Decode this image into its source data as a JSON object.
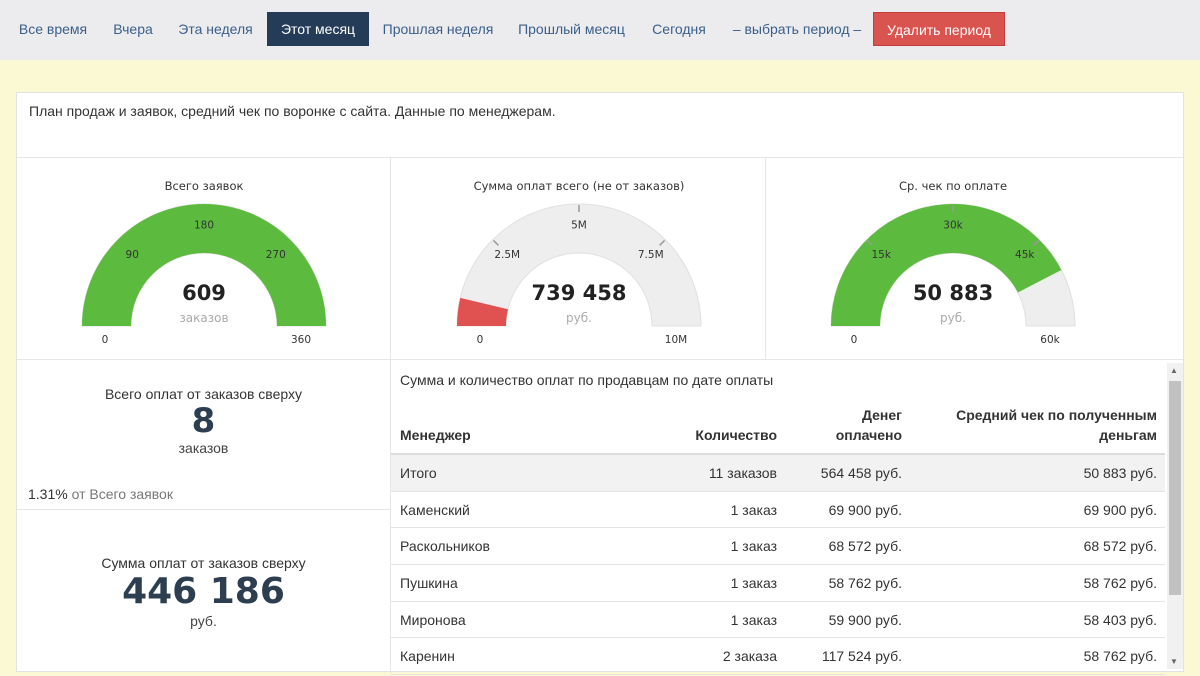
{
  "tabs": [
    {
      "label": "Все время",
      "active": false
    },
    {
      "label": "Вчера",
      "active": false
    },
    {
      "label": "Эта неделя",
      "active": false
    },
    {
      "label": "Этот месяц",
      "active": true
    },
    {
      "label": "Прошлая неделя",
      "active": false
    },
    {
      "label": "Прошлый месяц",
      "active": false
    },
    {
      "label": "Сегодня",
      "active": false
    },
    {
      "label": "– выбрать период –",
      "active": false
    },
    {
      "label": "Удалить период",
      "active": false
    }
  ],
  "description": "План продаж и заявок, средний чек по воронке с сайта. Данные по менеджерам.",
  "gauges": [
    {
      "title": "Всего заявок",
      "value": 609,
      "value_label": "609",
      "unit": "заказов",
      "min": 0,
      "max": 360,
      "min_label": "0",
      "max_label": "360",
      "ticks": [
        "90",
        "180",
        "270"
      ],
      "fill_color": "#5cbb3e",
      "track_color": "#eeeeee"
    },
    {
      "title": "Сумма оплат всего (не от заказов)",
      "value": 739458,
      "value_label": "739 458",
      "unit": "руб.",
      "min": 0,
      "max": 10000000,
      "min_label": "0",
      "max_label": "10M",
      "ticks": [
        "2.5M",
        "5M",
        "7.5M"
      ],
      "fill_color": "#e05252",
      "track_color": "#eeeeee"
    },
    {
      "title": "Ср. чек по оплате",
      "value": 50883,
      "value_label": "50 883",
      "unit": "руб.",
      "min": 0,
      "max": 60000,
      "min_label": "0",
      "max_label": "60k",
      "ticks": [
        "15k",
        "30k",
        "45k"
      ],
      "fill_color": "#5cbb3e",
      "track_color": "#eeeeee"
    }
  ],
  "stats": {
    "orders_paid": {
      "label": "Всего оплат от заказов сверху",
      "value": "8",
      "unit": "заказов"
    },
    "percent": {
      "value": "1.31%",
      "text": "от Всего заявок"
    },
    "sum_paid": {
      "label": "Сумма оплат от заказов сверху",
      "value": "446 186",
      "unit": "руб."
    }
  },
  "table": {
    "title": "Сумма и количество оплат по продавцам по дате оплаты",
    "headers": {
      "manager": "Менеджер",
      "count": "Количество",
      "money_1": "Денег",
      "money_2": "оплачено",
      "avg_1": "Средний чек по полученным",
      "avg_2": "деньгам"
    },
    "rows": [
      {
        "manager": "Итого",
        "count": "11 заказов",
        "money": "564 458 руб.",
        "avg": "50 883 руб.",
        "total": true
      },
      {
        "manager": "Каменский",
        "count": "1 заказ",
        "money": "69 900 руб.",
        "avg": "69 900 руб."
      },
      {
        "manager": "Раскольников",
        "count": "1 заказ",
        "money": "68 572 руб.",
        "avg": "68 572 руб."
      },
      {
        "manager": "Пушкина",
        "count": "1 заказ",
        "money": "58 762 руб.",
        "avg": "58 762 руб."
      },
      {
        "manager": "Миронова",
        "count": "1 заказ",
        "money": "59 900 руб.",
        "avg": "58 403 руб."
      },
      {
        "manager": "Каренин",
        "count": "2 заказа",
        "money": "117 524 руб.",
        "avg": "58 762 руб."
      }
    ]
  }
}
